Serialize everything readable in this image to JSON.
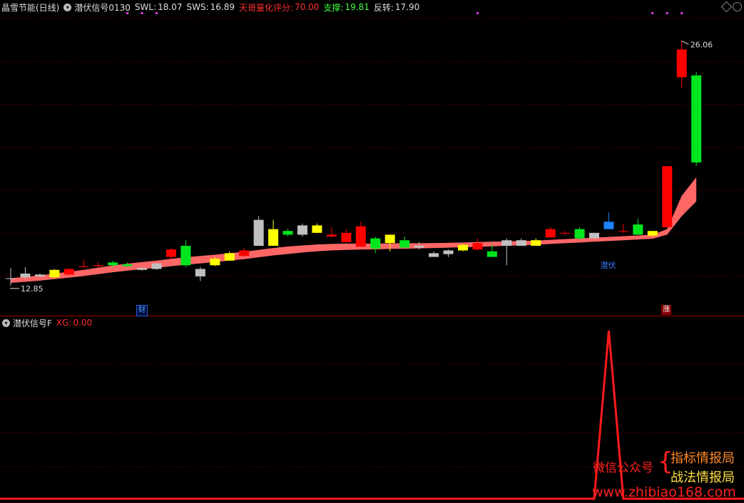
{
  "main_panel": {
    "stock_name": "晶雪节能(日线)",
    "indicator_name": "潜伏信号0130",
    "swl_label": "SWL:",
    "swl_value": "18.07",
    "sws_label": "SWS:",
    "sws_value": "16.89",
    "score_label": "天哥量化评分:",
    "score_value": "70.00",
    "support_label": "支撑:",
    "support_value": "19.81",
    "reversal_label": "反转:",
    "reversal_value": "17.90",
    "high_label": "26.06",
    "low_label": "12.85",
    "marker_cai": "财",
    "marker_qianfu": "潜伏",
    "marker_zhang": "涨"
  },
  "sub_panel": {
    "indicator_name": "潜伏信号F",
    "xg_label": "XG:",
    "xg_value": "0.00"
  },
  "watermark": {
    "left_text": "微信公众号",
    "line1": "指标情报局",
    "line2": "战法情报局",
    "url": "www.zhibiao168.com"
  },
  "colors": {
    "up": "#ff0000",
    "down": "#00e61e",
    "yellow": "#ffff00",
    "gray": "#c0c0c0",
    "blue": "#1e82ff",
    "band": "#ff6666"
  },
  "chart_data": [
    {
      "type": "candlestick",
      "title": "晶雪节能(日线)",
      "ylim": [
        11.5,
        27.5
      ],
      "candle_kinds": [
        "gray",
        "gray",
        "gray",
        "yellow",
        "red",
        "red",
        "red",
        "green",
        "green",
        "gray",
        "gray",
        "red",
        "green",
        "gray",
        "yellow",
        "yellow",
        "red",
        "gray",
        "yellow",
        "green",
        "gray",
        "yellow",
        "red",
        "red",
        "red",
        "green",
        "yellow",
        "green",
        "gray",
        "gray",
        "gray",
        "yellow",
        "red",
        "green",
        "gray",
        "gray",
        "yellow",
        "red",
        "red",
        "green",
        "gray",
        "blue",
        "red",
        "green",
        "yellow",
        "red",
        "red",
        "green"
      ],
      "open": [
        13.25,
        13.3,
        13.35,
        13.3,
        13.45,
        13.9,
        13.9,
        13.95,
        14.0,
        13.7,
        13.75,
        14.4,
        15.0,
        13.75,
        13.95,
        14.2,
        14.45,
        15.0,
        15.0,
        15.6,
        16.1,
        15.7,
        15.5,
        15.7,
        16.05,
        15.4,
        15.6,
        15.3,
        14.9,
        14.4,
        14.55,
        14.75,
        14.8,
        14.4,
        15.0,
        15.0,
        15.0,
        15.45,
        15.7,
        15.4,
        15.4,
        15.9,
        15.8,
        15.6,
        15.8,
        16.0,
        24.1,
        24.2
      ],
      "close": [
        13.25,
        13.5,
        13.45,
        13.7,
        13.75,
        13.9,
        13.95,
        14.1,
        13.9,
        13.8,
        14.05,
        14.8,
        13.95,
        13.35,
        14.3,
        14.6,
        14.75,
        16.4,
        15.9,
        15.8,
        15.6,
        16.1,
        15.6,
        15.2,
        14.95,
        14.85,
        15.15,
        14.9,
        15.0,
        14.6,
        14.75,
        15.05,
        15.15,
        14.7,
        15.3,
        15.3,
        15.3,
        15.9,
        15.7,
        15.9,
        15.7,
        16.3,
        15.8,
        16.15,
        15.55,
        19.3,
        25.6,
        19.5
      ],
      "high": [
        13.8,
        13.85,
        13.5,
        13.75,
        13.8,
        14.25,
        14.1,
        14.2,
        14.1,
        13.85,
        14.1,
        14.9,
        15.3,
        13.85,
        14.4,
        14.7,
        14.9,
        16.6,
        16.4,
        15.9,
        16.2,
        16.2,
        16.0,
        15.9,
        16.3,
        15.5,
        15.6,
        15.5,
        15.2,
        14.7,
        14.8,
        15.1,
        15.4,
        15.1,
        15.4,
        15.4,
        15.4,
        16.0,
        15.8,
        16.0,
        15.7,
        16.8,
        16.2,
        16.45,
        15.8,
        19.3,
        26.06,
        24.4
      ],
      "low": [
        12.85,
        13.2,
        13.3,
        13.25,
        13.4,
        13.8,
        13.85,
        13.85,
        13.85,
        13.65,
        13.7,
        14.3,
        13.85,
        13.1,
        13.9,
        14.2,
        14.4,
        15.0,
        15.0,
        15.5,
        15.5,
        15.7,
        15.45,
        15.2,
        14.95,
        14.6,
        14.7,
        14.9,
        14.8,
        14.4,
        14.4,
        14.7,
        14.75,
        14.4,
        13.95,
        15.0,
        15.0,
        15.45,
        15.6,
        15.3,
        15.35,
        15.9,
        15.7,
        15.6,
        15.5,
        16.0,
        23.5,
        19.3
      ],
      "band_upper": [
        13.25,
        13.32,
        13.4,
        13.5,
        13.6,
        13.7,
        13.82,
        13.94,
        14.04,
        14.12,
        14.2,
        14.3,
        14.38,
        14.45,
        14.52,
        14.6,
        14.68,
        14.78,
        14.88,
        14.96,
        15.02,
        15.07,
        15.1,
        15.12,
        15.12,
        15.12,
        15.13,
        15.14,
        15.14,
        15.15,
        15.16,
        15.18,
        15.2,
        15.22,
        15.24,
        15.26,
        15.28,
        15.32,
        15.36,
        15.4,
        15.44,
        15.48,
        15.52,
        15.56,
        15.6,
        15.9,
        17.7,
        18.7
      ],
      "band_lower": [
        13.0,
        13.06,
        13.12,
        13.2,
        13.28,
        13.37,
        13.47,
        13.57,
        13.66,
        13.74,
        13.81,
        13.9,
        13.98,
        14.05,
        14.12,
        14.2,
        14.28,
        14.38,
        14.48,
        14.56,
        14.64,
        14.7,
        14.75,
        14.78,
        14.8,
        14.81,
        14.83,
        14.84,
        14.86,
        14.88,
        14.9,
        14.92,
        14.94,
        14.97,
        15.0,
        15.03,
        15.06,
        15.1,
        15.14,
        15.18,
        15.22,
        15.26,
        15.3,
        15.34,
        15.38,
        15.6,
        16.6,
        17.4
      ],
      "high_point": {
        "index": 46,
        "value": 26.06
      },
      "low_point": {
        "index": 0,
        "value": 12.85
      },
      "top_dots_index": [
        8,
        9,
        10,
        32,
        44,
        45,
        46
      ],
      "qianfu_index": 41,
      "cai_index": 9,
      "zhang_index": 45
    },
    {
      "type": "line",
      "title": "潜伏信号F",
      "name": "XG",
      "ylim": [
        0,
        1
      ],
      "values": [
        0,
        0,
        0,
        0,
        0,
        0,
        0,
        0,
        0,
        0,
        0,
        0,
        0,
        0,
        0,
        0,
        0,
        0,
        0,
        0,
        0,
        0,
        0,
        0,
        0,
        0,
        0,
        0,
        0,
        0,
        0,
        0,
        0,
        0,
        0,
        0,
        0,
        0,
        0,
        0,
        0,
        1,
        0,
        0,
        0,
        0,
        0,
        0
      ]
    }
  ]
}
